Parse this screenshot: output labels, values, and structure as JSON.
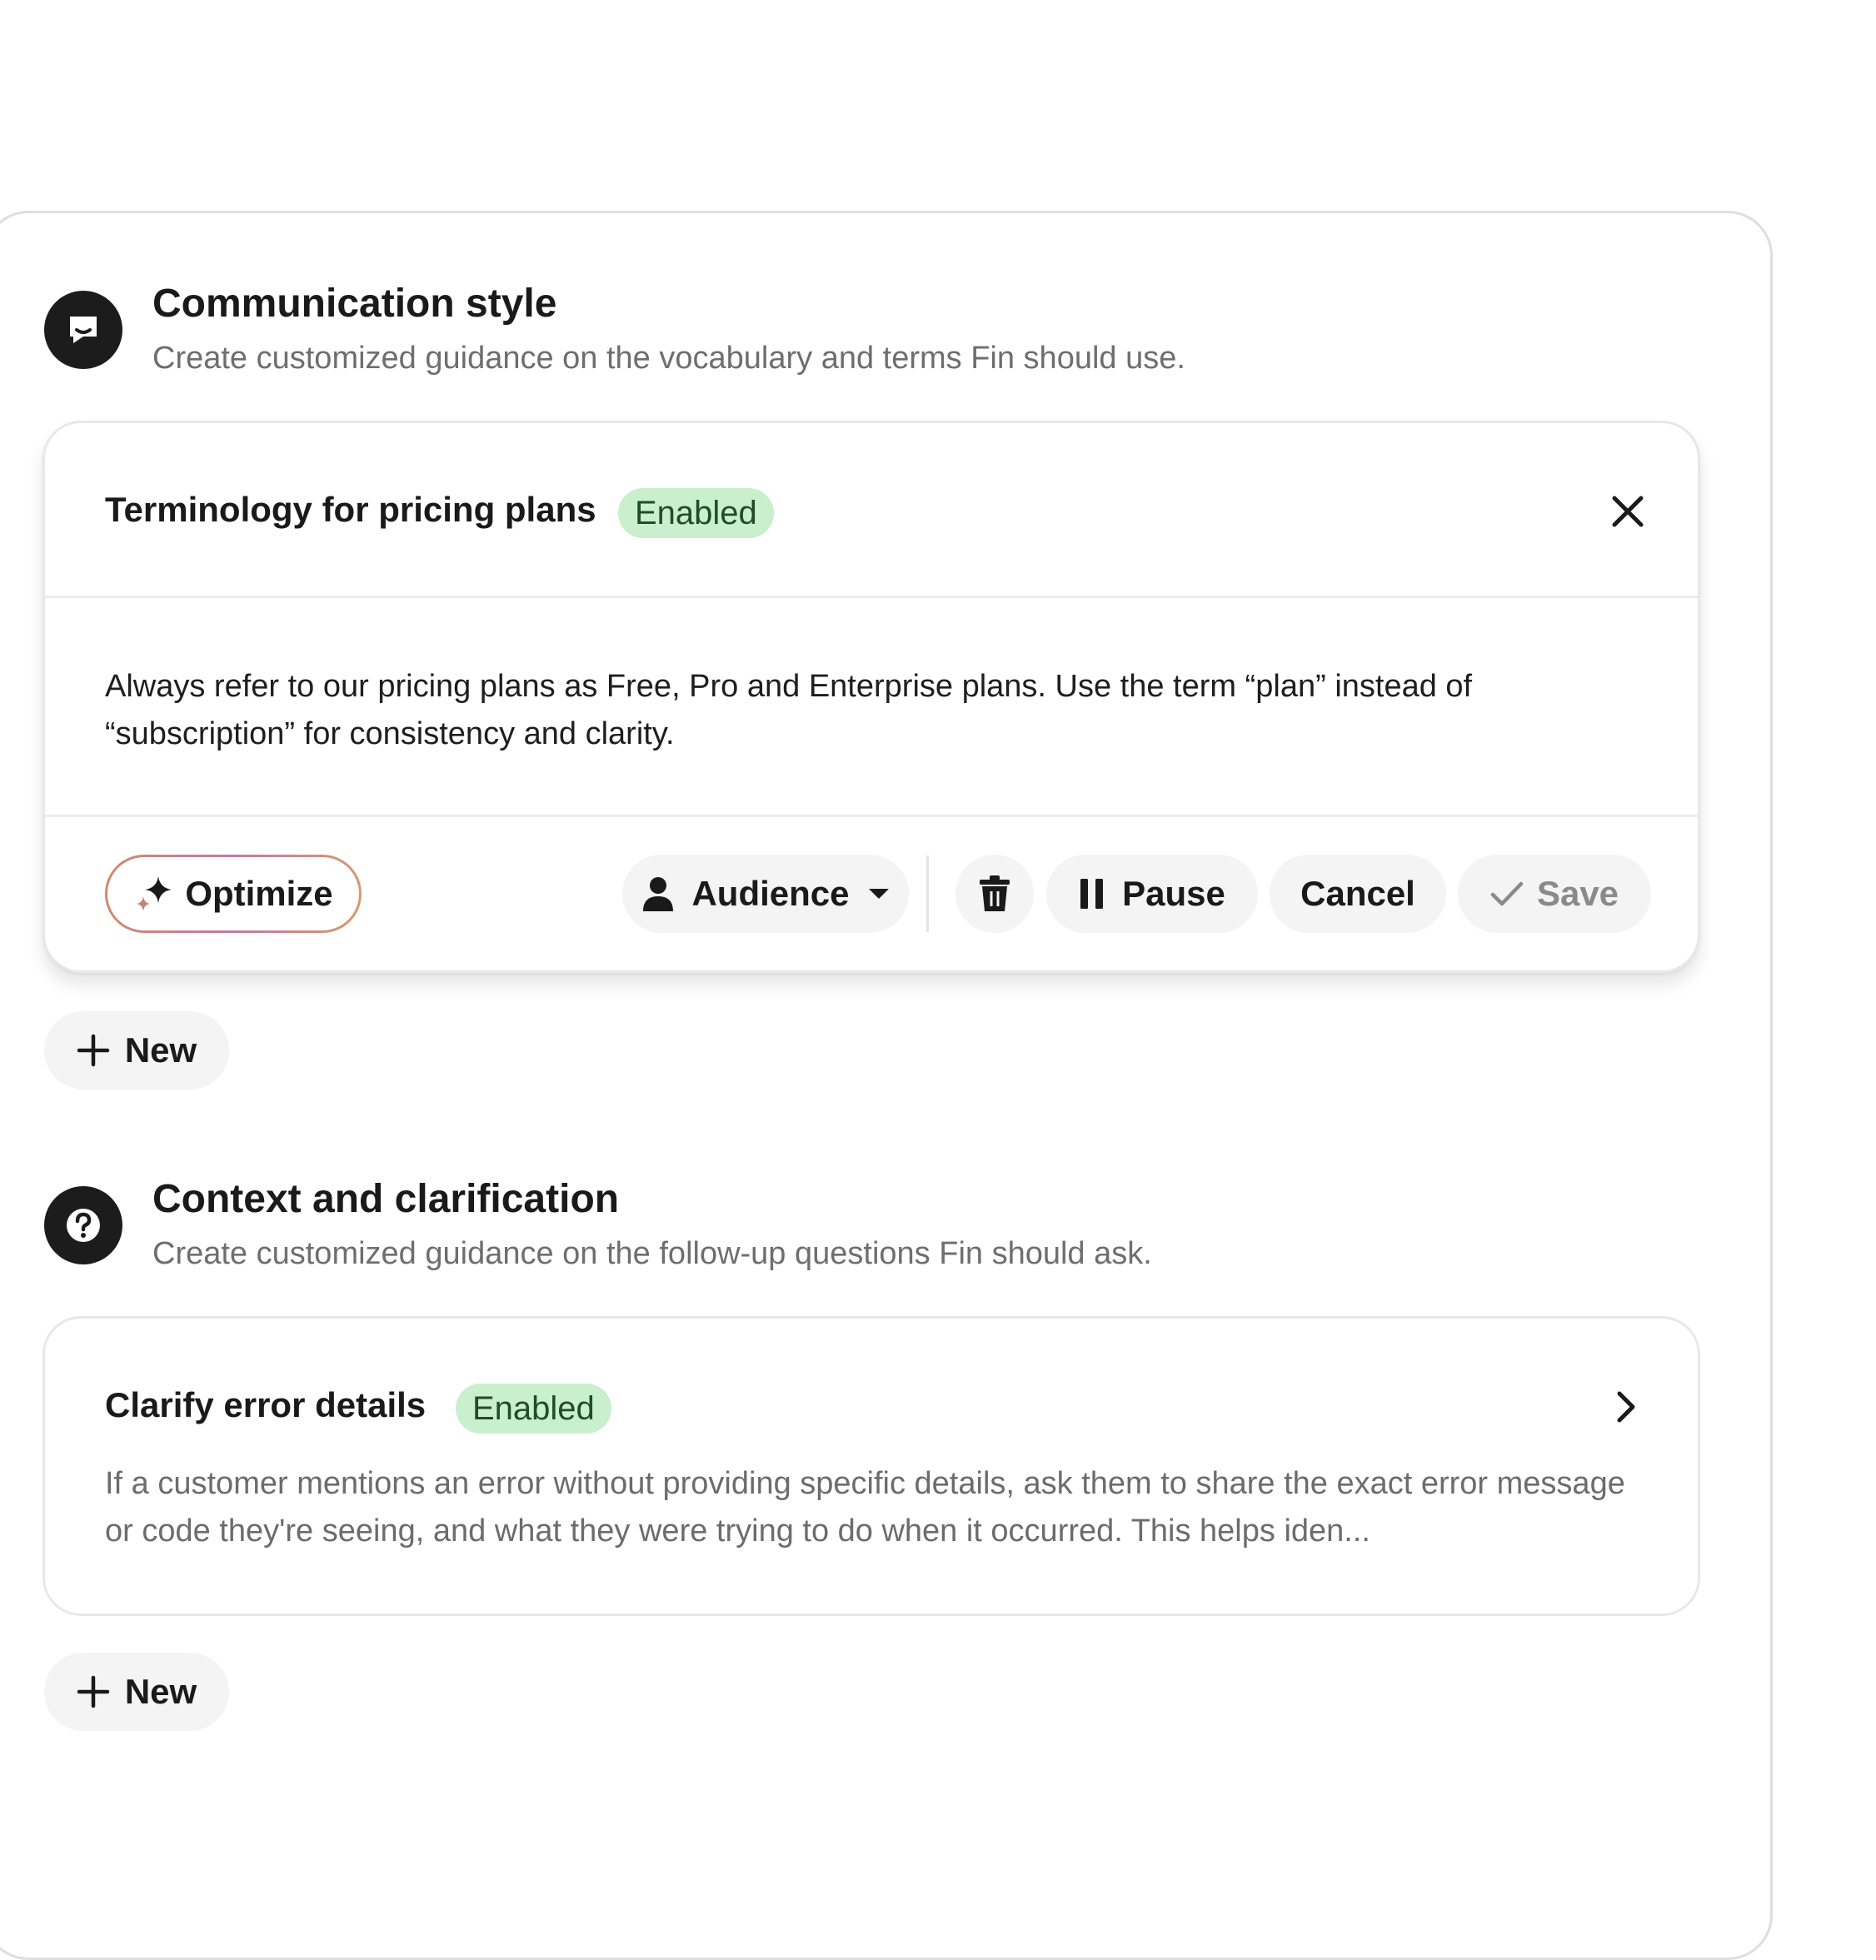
{
  "sections": [
    {
      "title": "Communication style",
      "subtitle": "Create customized guidance on the vocabulary and terms Fin should use.",
      "icon": "chat-bubble-icon",
      "card": {
        "title": "Terminology for pricing plans",
        "status": "Enabled",
        "body": "Always refer to our pricing plans as Free, Pro and Enterprise plans. Use the term “plan” instead of “subscription” for consistency and clarity.",
        "actions": {
          "optimize": "Optimize",
          "audience": "Audience",
          "pause": "Pause",
          "cancel": "Cancel",
          "save": "Save"
        }
      },
      "new_label": "New"
    },
    {
      "title": "Context and clarification",
      "subtitle": "Create customized guidance on the follow-up questions Fin should ask.",
      "icon": "question-mark-icon",
      "card": {
        "title": "Clarify error details",
        "status": "Enabled",
        "body": "If a customer mentions an error without providing specific details, ask them to share the exact error message or code they're seeing, and what they were trying to do when it occurred. This helps iden..."
      },
      "new_label": "New"
    }
  ],
  "colors": {
    "badge_bg": "#c9efcd",
    "badge_text": "#1e4d27",
    "icon_bg": "#1c1c1c",
    "button_bg": "#f4f4f4",
    "save_disabled_text": "#8a8a8a"
  }
}
